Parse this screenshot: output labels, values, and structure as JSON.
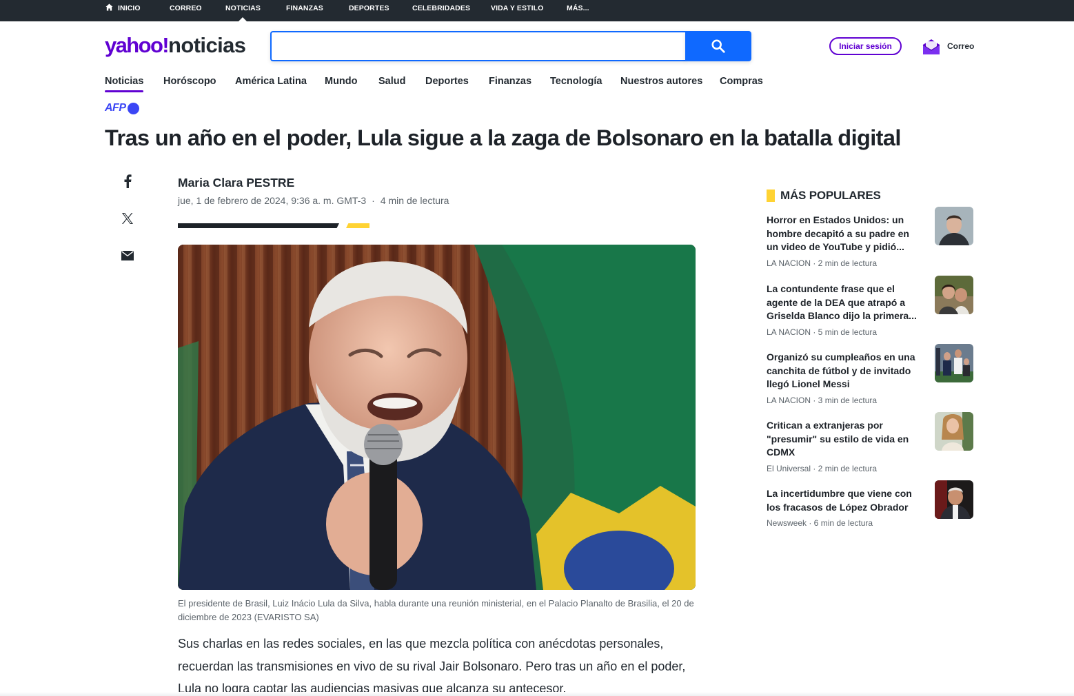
{
  "topnav": {
    "items": [
      {
        "label": "INICIO"
      },
      {
        "label": "CORREO"
      },
      {
        "label": "NOTICIAS"
      },
      {
        "label": "FINANZAS"
      },
      {
        "label": "DEPORTES"
      },
      {
        "label": "CELEBRIDADES"
      },
      {
        "label": "VIDA Y ESTILO"
      },
      {
        "label": "MÁS..."
      }
    ],
    "active": "NOTICIAS"
  },
  "header": {
    "logo_brand": "yahoo",
    "logo_mark": "!",
    "logo_section": "noticias",
    "search": {
      "value": "",
      "placeholder": ""
    },
    "signin_label": "Iniciar sesión",
    "mail_label": "Correo"
  },
  "subnav": {
    "items": [
      {
        "label": "Noticias"
      },
      {
        "label": "Horóscopo"
      },
      {
        "label": "América Latina"
      },
      {
        "label": "Mundo"
      },
      {
        "label": "Salud"
      },
      {
        "label": "Deportes"
      },
      {
        "label": "Finanzas"
      },
      {
        "label": "Tecnología"
      },
      {
        "label": "Nuestros autores"
      },
      {
        "label": "Compras"
      }
    ],
    "active": "Noticias"
  },
  "article": {
    "provider": "AFP",
    "headline": "Tras un año en el poder, Lula sigue a la zaga de Bolsonaro en la batalla digital",
    "author": "Maria Clara PESTRE",
    "date": "jue, 1 de febrero de 2024, 9:36 a. m. GMT-3",
    "meta_sep": "·",
    "read_time": "4  min de lectura",
    "caption": "El presidente de Brasil, Luiz Inácio Lula da Silva, habla durante una reunión ministerial, en el Palacio Planalto de Brasilia, el 20 de diciembre de 2023 (EVARISTO SA)",
    "body": "Sus charlas en las redes sociales, en las que mezcla política con anécdotas personales, recuerdan las transmisiones en vivo de su rival Jair Bolsonaro. Pero tras un año en el poder, Lula no logra captar las audiencias masivas que alcanza su antecesor."
  },
  "share": {
    "icons": [
      "facebook-icon",
      "x-icon",
      "mail-icon"
    ]
  },
  "popular": {
    "title": "MÁS POPULARES",
    "items": [
      {
        "title": "Horror en Estados Unidos: un hombre decapitó a su padre en un video de YouTube y pidió...",
        "meta": "LA NACION · 2  min de lectura"
      },
      {
        "title": "La contundente frase que el agente de la DEA que atrapó a Griselda Blanco dijo la primera...",
        "meta": "LA NACION · 5  min de lectura"
      },
      {
        "title": "Organizó su cumpleaños en una canchita de fútbol y de invitado llegó Lionel Messi",
        "meta": "LA NACION · 3  min de lectura"
      },
      {
        "title": "Critican a extranjeras por \"presumir\" su estilo de vida en CDMX",
        "meta": "El Universal · 2  min de lectura"
      },
      {
        "title": "La incertidumbre que viene con los fracasos de López Obrador",
        "meta": "Newsweek · 6  min de lectura"
      }
    ]
  },
  "colors": {
    "brand": "#6001d2",
    "search_blue": "#0f69ff",
    "topbar": "#232a31",
    "accent_yellow": "#ffd333",
    "afp_blue": "#3b46f5"
  }
}
